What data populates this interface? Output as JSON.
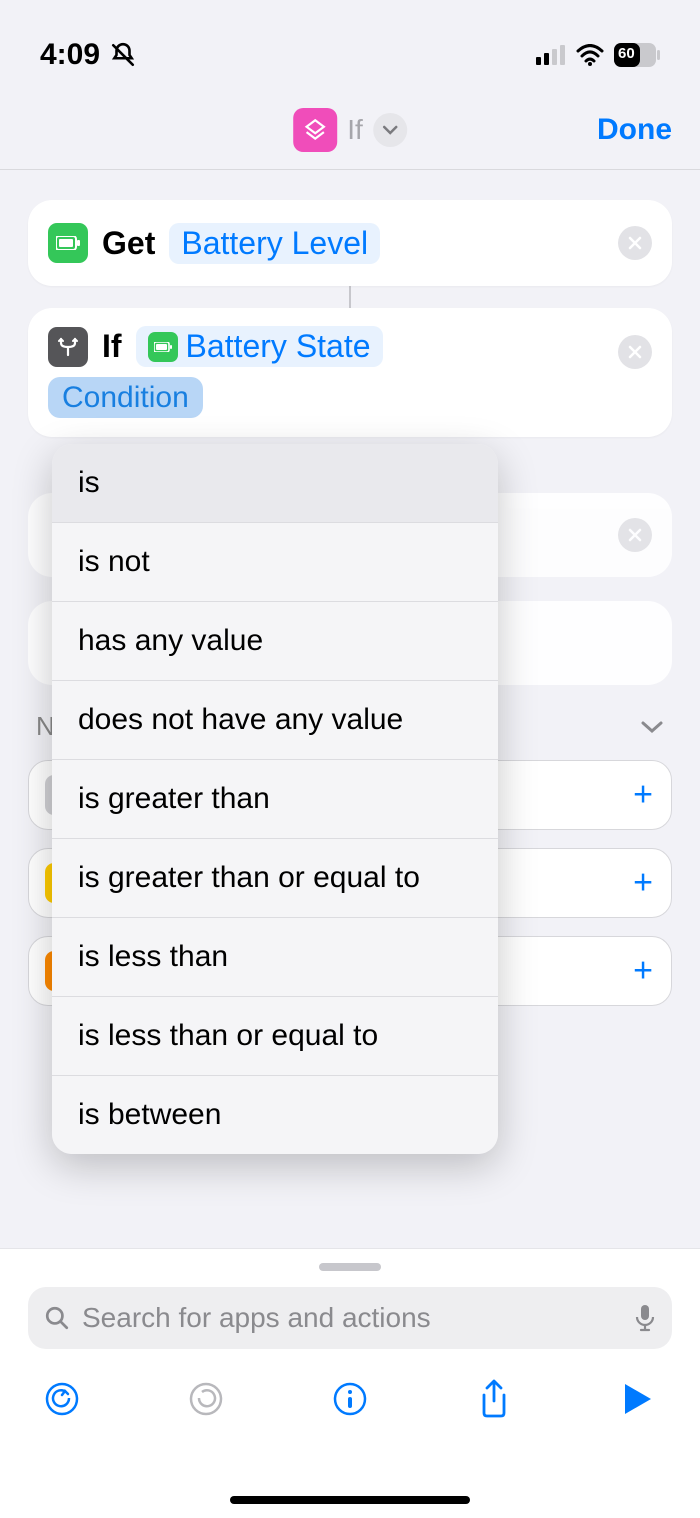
{
  "status_bar": {
    "time": "4:09",
    "battery_pct": "60"
  },
  "nav": {
    "title": "If",
    "done": "Done"
  },
  "action_get": {
    "verb": "Get",
    "param": "Battery Level"
  },
  "action_if": {
    "verb": "If",
    "param": "Battery State",
    "condition_pill": "Condition"
  },
  "dropdown": {
    "items": [
      "is",
      "is not",
      "has any value",
      "does not have any value",
      "is greater than",
      "is greater than or equal to",
      "is less than",
      "is less than or equal to",
      "is between"
    ]
  },
  "section": {
    "title_visible": "N"
  },
  "search": {
    "placeholder": "Search for apps and actions"
  }
}
